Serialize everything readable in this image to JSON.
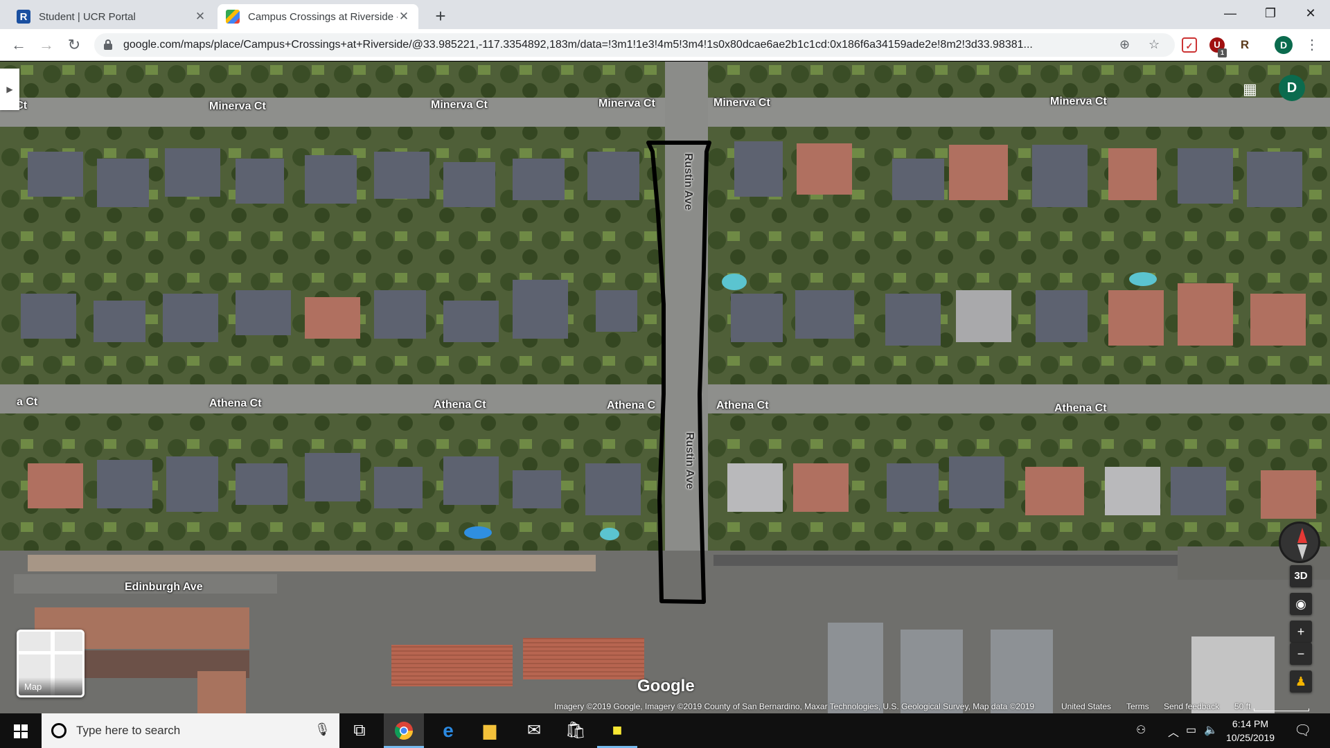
{
  "browser": {
    "tabs": [
      {
        "title": "Student | UCR Portal",
        "favicon": "ucr-r-logo",
        "active": false
      },
      {
        "title": "Campus Crossings at Riverside - ",
        "favicon": "google-maps-logo",
        "active": true
      }
    ],
    "new_tab_label": "+",
    "window_controls": {
      "minimize": "—",
      "restore": "❐",
      "close": "✕"
    },
    "url": "google.com/maps/place/Campus+Crossings+at+Riverside/@33.985221,-117.3354892,183m/data=!3m1!1e3!4m5!3m4!1s0x80dcae6ae2b1c1cd:0x186f6a34159ade2e!8m2!3d33.98381...",
    "profile_initial": "D",
    "extension_badge": "1"
  },
  "map": {
    "streets": {
      "minerva": "Minerva Ct",
      "minerva_clipped": "va Ct",
      "athena": "Athena Ct",
      "athena_partial": "Athena C",
      "athena_clipped": "a Ct",
      "rustin": "Rustin Ave",
      "edinburgh": "Edinburgh Ave"
    },
    "profile_initial": "D",
    "controls": {
      "threed": "3D",
      "zoom_in": "+",
      "zoom_out": "−"
    },
    "minimap_label": "Map",
    "google_logo": "Google",
    "attribution": "Imagery ©2019 Google, Imagery ©2019 County of San Bernardino, Maxar Technologies, U.S. Geological Survey, Map data ©2019",
    "country": "United States",
    "terms": "Terms",
    "feedback": "Send feedback",
    "scale": "50 ft"
  },
  "taskbar": {
    "search_placeholder": "Type here to search",
    "time": "6:14 PM",
    "date": "10/25/2019"
  }
}
